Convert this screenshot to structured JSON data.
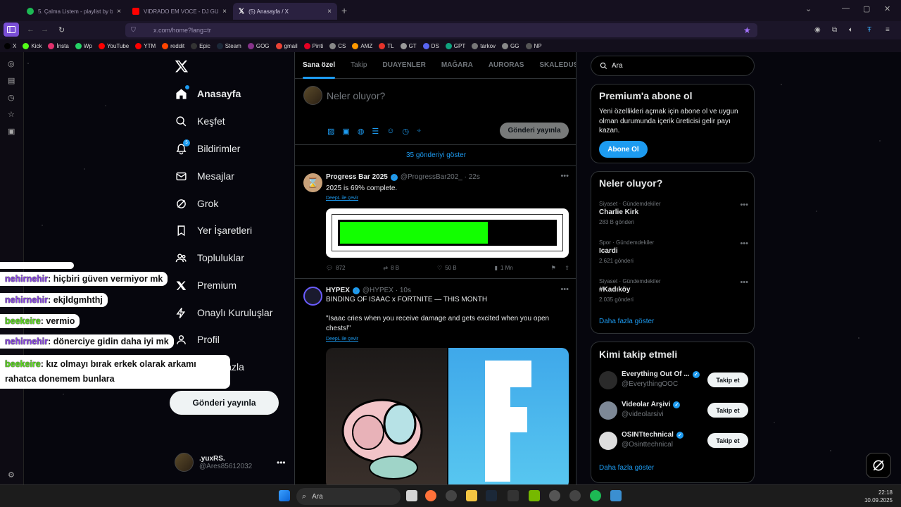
{
  "browser": {
    "tabs": [
      {
        "title": "5. Çalma Listem - playlist by be",
        "color": "#1db954",
        "active": false
      },
      {
        "title": "VIDRADO EM VOCE - DJ GUUG",
        "color": "#ff0000",
        "active": false
      },
      {
        "title": "(5) Anasayfa / X",
        "color": "#000000",
        "active": true
      }
    ],
    "url": "x.com/home?lang=tr",
    "bookmarks": [
      {
        "label": "X",
        "color": "#000"
      },
      {
        "label": "Kick",
        "color": "#53fc18"
      },
      {
        "label": "İnsta",
        "color": "#e1306c"
      },
      {
        "label": "Wp",
        "color": "#25d366"
      },
      {
        "label": "YouTube",
        "color": "#ff0000"
      },
      {
        "label": "YTM",
        "color": "#ff0000"
      },
      {
        "label": "reddit",
        "color": "#ff4500"
      },
      {
        "label": "Epic",
        "color": "#333"
      },
      {
        "label": "Steam",
        "color": "#1b2838"
      },
      {
        "label": "GOG",
        "color": "#86328a"
      },
      {
        "label": "gmail",
        "color": "#ea4335"
      },
      {
        "label": "Pinti",
        "color": "#e60023"
      },
      {
        "label": "CS",
        "color": "#888"
      },
      {
        "label": "AMZ",
        "color": "#ff9900"
      },
      {
        "label": "TL",
        "color": "#e5332a"
      },
      {
        "label": "GT",
        "color": "#999"
      },
      {
        "label": "DS",
        "color": "#5865f2"
      },
      {
        "label": "GPT",
        "color": "#10a37f"
      },
      {
        "label": "tarkov",
        "color": "#777"
      },
      {
        "label": "GG",
        "color": "#888"
      },
      {
        "label": "NP",
        "color": "#555"
      }
    ]
  },
  "nav": {
    "items": [
      {
        "label": "Anasayfa",
        "icon": "home-icon",
        "selected": true
      },
      {
        "label": "Keşfet",
        "icon": "search-icon"
      },
      {
        "label": "Bildirimler",
        "icon": "bell-icon",
        "badge": "5"
      },
      {
        "label": "Mesajlar",
        "icon": "mail-icon"
      },
      {
        "label": "Grok",
        "icon": "grok-icon"
      },
      {
        "label": "Yer İşaretleri",
        "icon": "bookmark-icon"
      },
      {
        "label": "Topluluklar",
        "icon": "people-icon"
      },
      {
        "label": "Premium",
        "icon": "x-icon"
      },
      {
        "label": "Onaylı Kuruluşlar",
        "icon": "lightning-icon"
      },
      {
        "label": "Profil",
        "icon": "person-icon"
      },
      {
        "label": "Daha fazla",
        "icon": "more-icon"
      }
    ],
    "post_label": "Gönderi yayınla",
    "user_name": ".yuxRS.",
    "user_handle": "@Ares85612032"
  },
  "chat": [
    {
      "nick": "nehirnehir",
      "color": "purple",
      "text": ": hiçbiri güven vermiyor mk"
    },
    {
      "nick": "nehirnehir",
      "color": "purple",
      "text": ": ekjldgmhthj"
    },
    {
      "nick": "beekeire",
      "color": "green",
      "text": ": vermio"
    },
    {
      "nick": "nehirnehir",
      "color": "purple",
      "text": ": dönerciye gidin daha iyi mk"
    },
    {
      "nick": "beekeire",
      "color": "green",
      "text": ": kız olmayı bırak erkek olarak arkamı",
      "text2": "rahatca donemem bunlara"
    }
  ],
  "feed": {
    "tabs": [
      "Sana özel",
      "Takip",
      "DUAYENLER",
      "MAĞARA",
      "AURORAS",
      "SKALEDUS M"
    ],
    "compose_placeholder": "Neler oluyor?",
    "compose_post": "Gönderi yayınla",
    "show_more": "35 gönderiyi göster",
    "tweets": [
      {
        "name": "Progress Bar 2025",
        "handle": "@ProgressBar202_ · 22s",
        "text": "2025 is 69% complete.",
        "translate": "DeepL ile çevir",
        "progress": 0.69,
        "replies": "872",
        "retweets": "8 B",
        "likes": "50 B",
        "views": "1 Mn"
      },
      {
        "name": "HYPEX",
        "handle": "@HYPEX · 10s",
        "text1": "BINDING OF ISAAC x FORTNITE — THIS MONTH",
        "text2": "\"Isaac cries when you receive damage and gets excited when you open",
        "text3": "chests!\"",
        "translate": "DeepL ile çevir"
      }
    ]
  },
  "right": {
    "search_placeholder": "Ara",
    "premium": {
      "title": "Premium'a abone ol",
      "line1": "Yeni özellikleri açmak için abone ol ve uygun",
      "line2": "olman durumunda içerik üreticisi gelir payı",
      "line3": "kazan.",
      "button": "Abone Ol"
    },
    "trends": {
      "title": "Neler oluyor?",
      "items": [
        {
          "category": "Siyaset · Gündemdekiler",
          "name": "Charlie Kirk",
          "count": "283 B gönderi"
        },
        {
          "category": "Spor · Gündemdekiler",
          "name": "Icardi",
          "count": "2.621 gönderi"
        },
        {
          "category": "Siyaset · Gündemdekiler",
          "name": "#Kadıköy",
          "count": "2.035 gönderi"
        }
      ],
      "more": "Daha fazla göster"
    },
    "who": {
      "title": "Kimi takip etmeli",
      "items": [
        {
          "name": "Everything Out Of ...",
          "handle": "@EverythingOOC",
          "button": "Takip et"
        },
        {
          "name": "Videolar Arşivi",
          "handle": "@videolarsivi",
          "button": "Takip et"
        },
        {
          "name": "OSINTtechnical",
          "handle": "@Osinttechnical",
          "button": "Takip et"
        }
      ],
      "more": "Daha fazla göster"
    }
  },
  "taskbar": {
    "search": "Ara",
    "time": "22:18",
    "date": "10.09.2025"
  }
}
